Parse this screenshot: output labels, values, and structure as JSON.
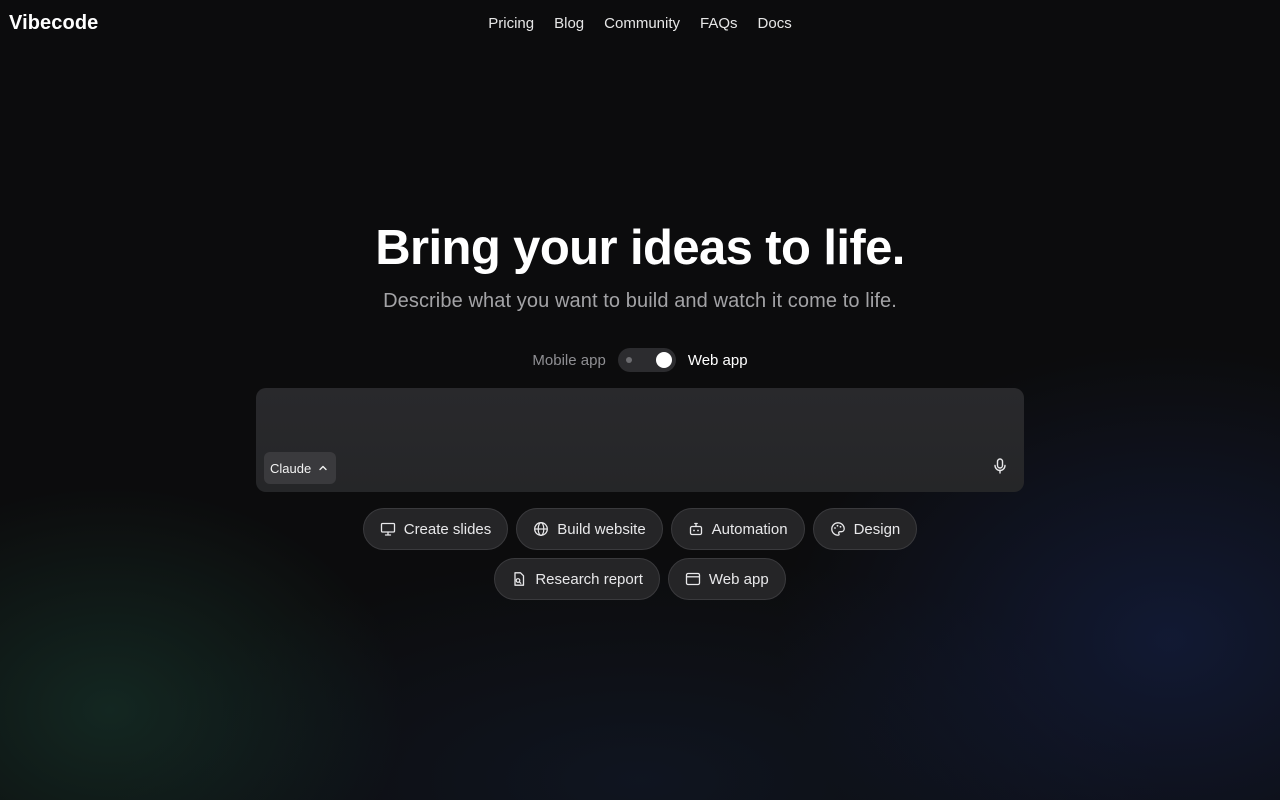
{
  "header": {
    "brand": "Vibecode",
    "nav": [
      "Pricing",
      "Blog",
      "Community",
      "FAQs",
      "Docs"
    ]
  },
  "hero": {
    "title": "Bring your ideas to life.",
    "subtitle": "Describe what you want to build and watch it come to life."
  },
  "mode_toggle": {
    "left_label": "Mobile app",
    "right_label": "Web app",
    "selected": "Web app"
  },
  "prompt": {
    "value": "",
    "placeholder": "",
    "model_label": "Claude",
    "model_icon": "chevron-up-icon",
    "mic_icon": "microphone-icon"
  },
  "suggestions": {
    "row1": [
      {
        "label": "Create slides",
        "icon": "presentation-icon"
      },
      {
        "label": "Build website",
        "icon": "globe-icon"
      },
      {
        "label": "Automation",
        "icon": "robot-icon"
      },
      {
        "label": "Design",
        "icon": "palette-icon"
      }
    ],
    "row2": [
      {
        "label": "Research report",
        "icon": "document-search-icon"
      },
      {
        "label": "Web app",
        "icon": "browser-window-icon"
      }
    ]
  },
  "colors": {
    "background": "#0c0c0d",
    "accent": "#ffffff",
    "muted_text": "#a3a3a6"
  }
}
